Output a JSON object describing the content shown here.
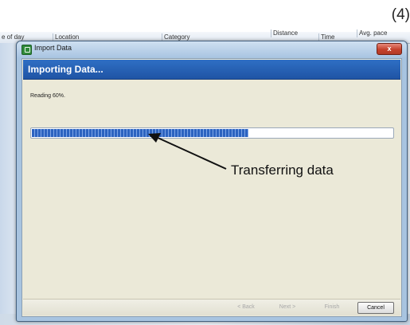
{
  "step_label": "(4)",
  "background_app": {
    "columns": [
      "e of day",
      "Location",
      "Category",
      "Distance",
      "Time",
      "Avg. pace"
    ]
  },
  "dialog": {
    "title": "Import Data",
    "close_symbol": "x",
    "heading": "Importing Data...",
    "status": "Reading 60%.",
    "progress_percent": 60,
    "buttons": {
      "back": "< Back",
      "next": "Next >",
      "finish": "Finish",
      "cancel": "Cancel"
    }
  },
  "annotation": {
    "text": "Transferring data"
  },
  "icons": {
    "app_icon": "import-data-icon",
    "close": "close-icon"
  },
  "colors": {
    "banner": "#2f6fc4",
    "progress": "#2c63c0",
    "close": "#c5412c",
    "client_bg": "#ebe9d8"
  }
}
